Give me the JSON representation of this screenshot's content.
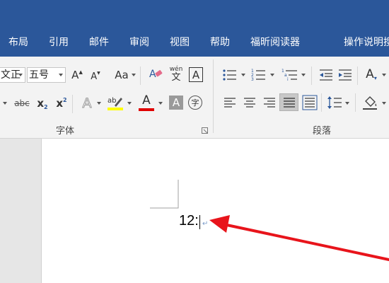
{
  "menu": {
    "items": [
      "布局",
      "引用",
      "邮件",
      "审阅",
      "视图",
      "帮助",
      "福昕阅读器"
    ],
    "tell_me": "操作说明搜"
  },
  "ribbon": {
    "font_name": "文正",
    "font_size": "五号",
    "group_font_label": "字体",
    "group_paragraph_label": "段落",
    "phonetic_top": "wén",
    "phonetic_bottom": "文",
    "bordered_char": "A",
    "strikethrough": "abc",
    "subscript": "x",
    "subscript_mark": "2",
    "superscript": "x",
    "superscript_mark": "2",
    "change_case": "Aa",
    "grow_font": "A",
    "shrink_font": "A",
    "text_effect": "A",
    "highlight_sample": "ab",
    "font_color_letter": "A",
    "char_shading": "A",
    "enclose_char": "字",
    "styles_letter": "A",
    "highlight_color": "#ffff00",
    "font_color": "#e00000",
    "accent": "#2b579a"
  },
  "document": {
    "text": "12:",
    "paragraph_mark": "↵"
  },
  "annotation": {
    "arrow_color": "#e8141b"
  }
}
